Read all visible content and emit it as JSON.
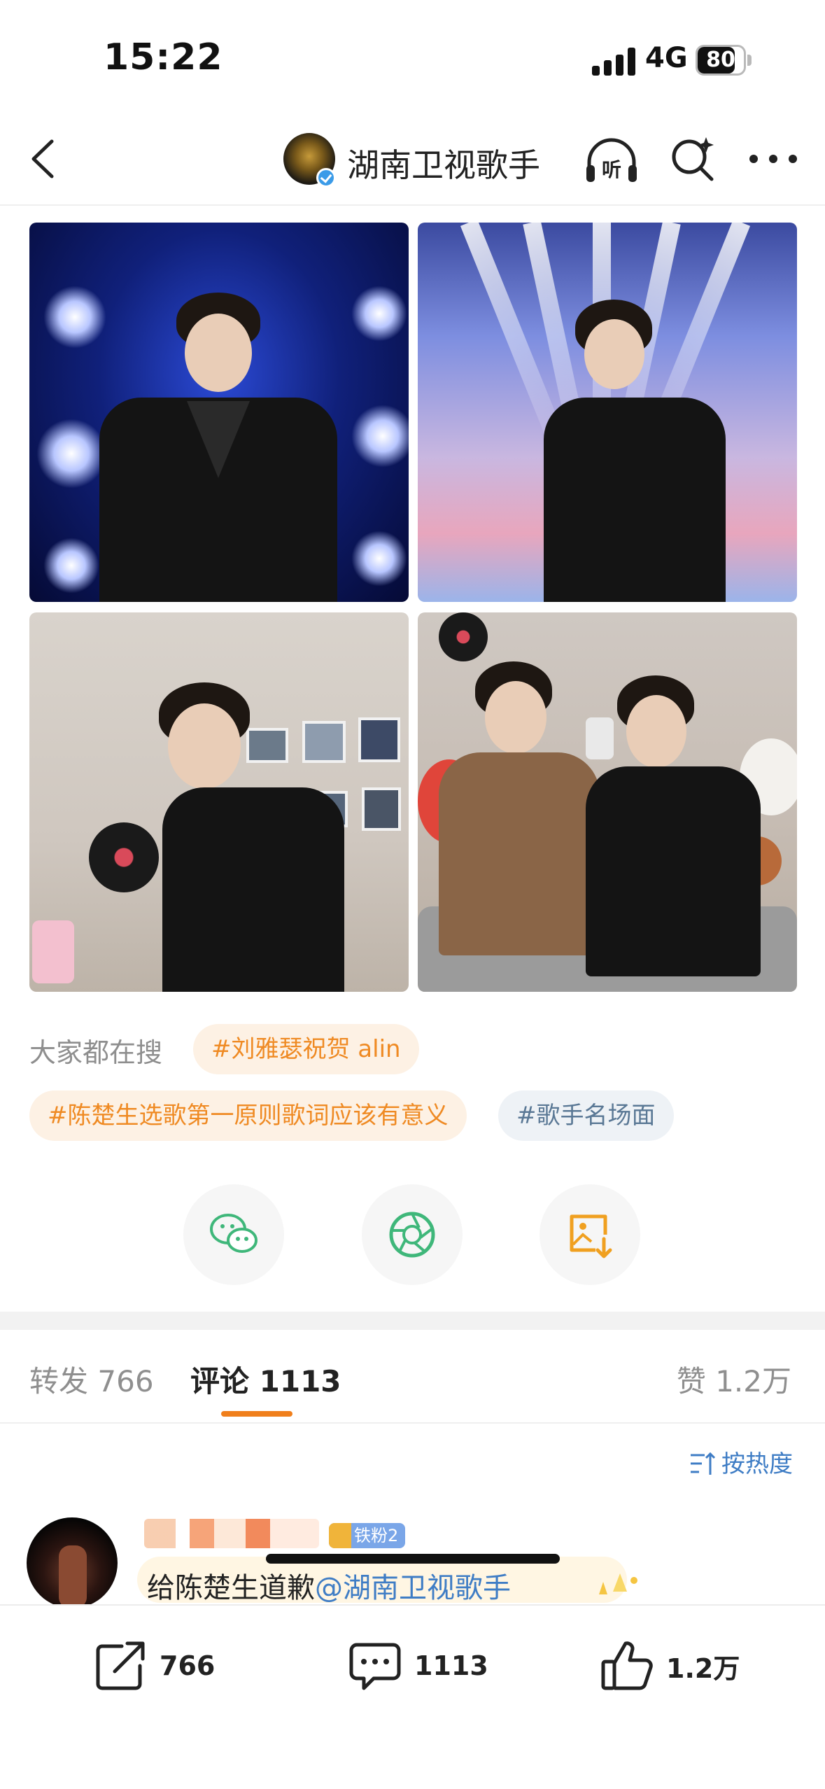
{
  "status_bar": {
    "time": "15:22",
    "network": "4G",
    "battery": "80",
    "battery_level": 0.8
  },
  "nav": {
    "account_name": "湖南卫视歌手",
    "listen_label": "听"
  },
  "trending": {
    "label": "大家都在搜",
    "tags": [
      "#刘雅瑟祝贺 alin",
      "#陈楚生选歌第一原则歌词应该有意义",
      "#歌手名场面"
    ]
  },
  "tabs": {
    "repost_label": "转发",
    "repost_count": "766",
    "comment_label": "评论",
    "comment_count": "1113",
    "like_label": "赞",
    "like_count": "1.2万"
  },
  "sort": {
    "label": "按热度"
  },
  "comment": {
    "fan_badge": "铁粉2",
    "text": "给陈楚生道歉",
    "mention": "@湖南卫视歌手"
  },
  "bottom_bar": {
    "repost": "766",
    "comment": "1113",
    "like": "1.2万"
  },
  "colors": {
    "accent": "#f07f1b",
    "link": "#3f7dc5",
    "tag_orange": "#ef8a23",
    "tag_blue": "#5a7895"
  }
}
